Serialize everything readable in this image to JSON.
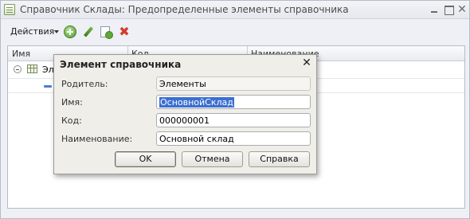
{
  "window": {
    "title": "Справочник Склады: Предопределенные элементы справочника"
  },
  "toolbar": {
    "actions_label": "Действия",
    "add_icon": "add-icon",
    "edit_icon": "edit-icon",
    "copy_icon": "copy-icon",
    "delete_icon": "delete-icon"
  },
  "list": {
    "columns": [
      "Имя",
      "Код",
      "Наименование"
    ],
    "rows": [
      {
        "name": "Элементы"
      }
    ]
  },
  "dialog": {
    "title": "Элемент справочника",
    "fields": {
      "parent": {
        "label": "Родитель:",
        "value": "Элементы"
      },
      "name": {
        "label": "Имя:",
        "value": "ОсновнойСклад"
      },
      "code": {
        "label": "Код:",
        "value": "000000001"
      },
      "title": {
        "label": "Наименование:",
        "value": "Основной склад"
      }
    },
    "buttons": {
      "ok": "OK",
      "cancel": "Отмена",
      "help": "Справка"
    }
  }
}
